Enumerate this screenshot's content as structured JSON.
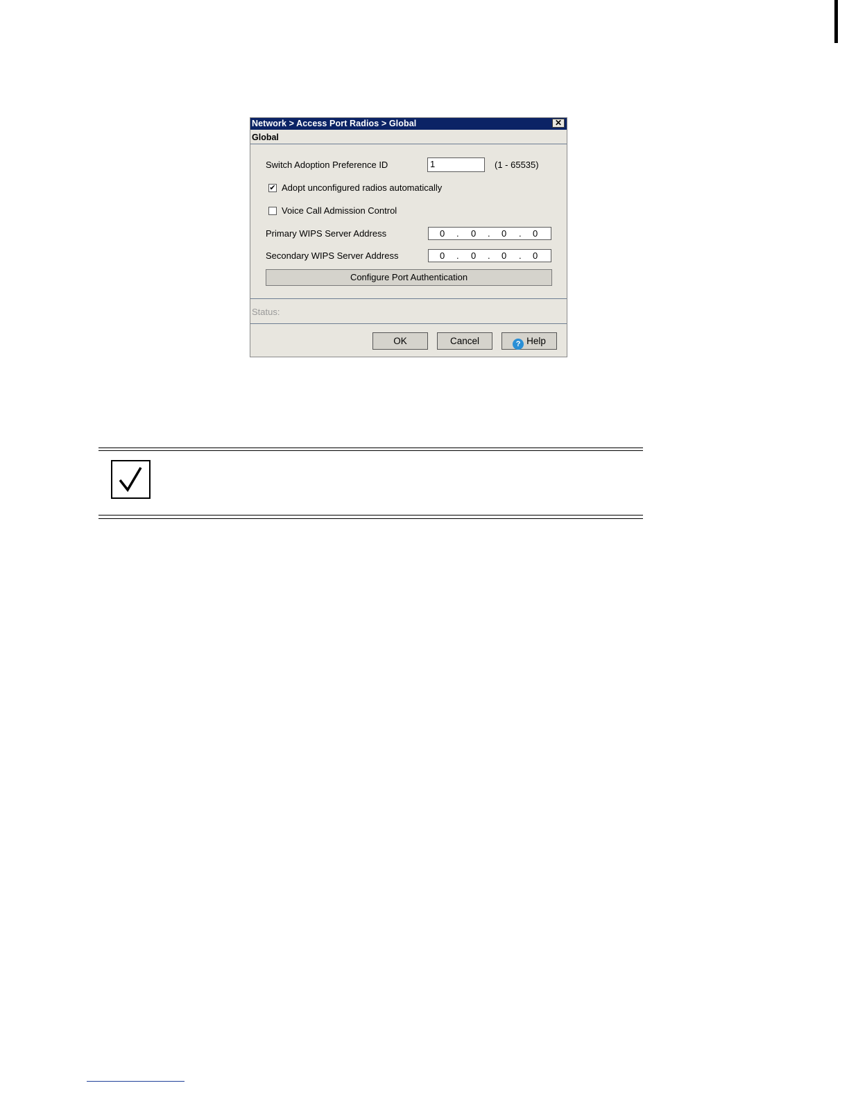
{
  "dialog": {
    "title": "Network > Access Port Radios > Global",
    "section_header": "Global",
    "adoption_pref": {
      "label": "Switch Adoption Preference ID",
      "value": "1",
      "range": "(1 - 65535)"
    },
    "adopt_unconfigured": {
      "label": "Adopt unconfigured radios automatically",
      "checked": true,
      "mark": "✔"
    },
    "voice_cac": {
      "label": "Voice Call Admission Control",
      "checked": false
    },
    "primary_wips": {
      "label": "Primary WIPS Server Address",
      "octets": [
        "0",
        "0",
        "0",
        "0"
      ],
      "dot": "."
    },
    "secondary_wips": {
      "label": "Secondary WIPS Server Address",
      "octets": [
        "0",
        "0",
        "0",
        "0"
      ],
      "dot": "."
    },
    "configure_port_auth": "Configure Port Authentication",
    "status_label": "Status:",
    "buttons": {
      "ok": "OK",
      "cancel": "Cancel",
      "help": "Help",
      "help_glyph": "?"
    },
    "close_glyph": "✕"
  },
  "note_icon": "checkmark-icon"
}
